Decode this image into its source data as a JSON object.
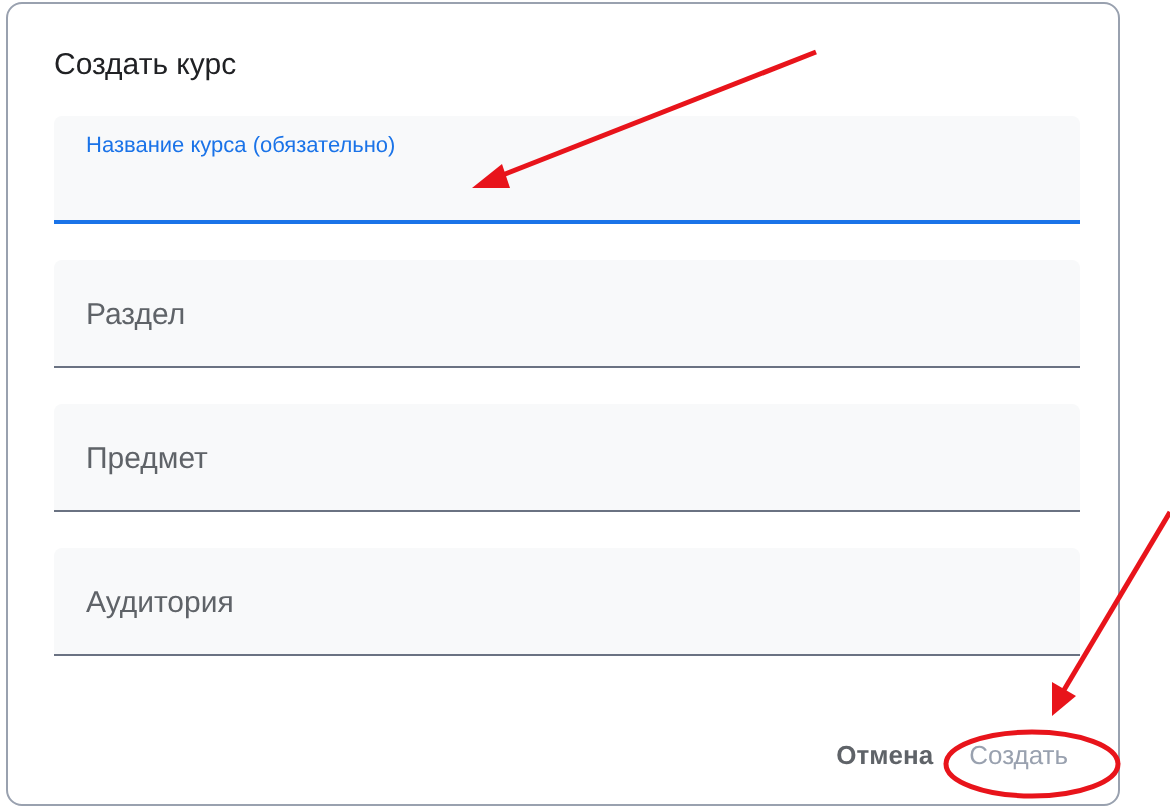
{
  "dialog": {
    "title": "Создать курс",
    "fields": [
      {
        "label": "Название курса (обязательно)",
        "focused": true
      },
      {
        "label": "Раздел",
        "focused": false
      },
      {
        "label": "Предмет",
        "focused": false
      },
      {
        "label": "Аудитория",
        "focused": false
      }
    ],
    "buttons": [
      {
        "label": "Отмена",
        "disabled": false
      },
      {
        "label": "Создать",
        "disabled": true
      }
    ]
  }
}
